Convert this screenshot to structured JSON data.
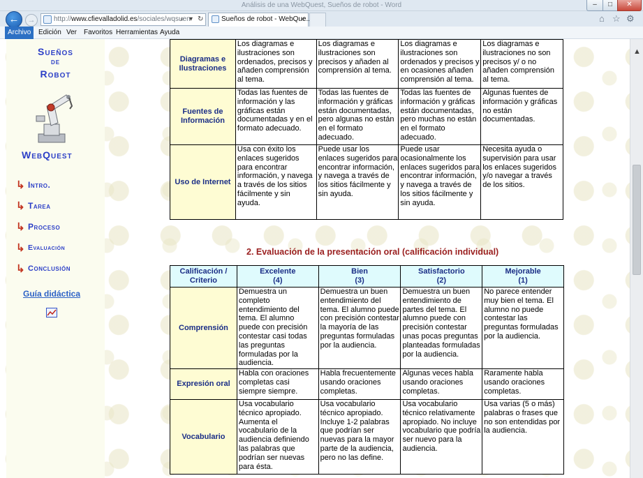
{
  "window": {
    "title": "Análisis de una WebQuest, Sueños de robot - Word"
  },
  "browser": {
    "address_domain": "www.cfievalladolid.es",
    "address_path": "/sociales/wqsuen",
    "address_prefix": "http://",
    "tab_title": "Sueños de robot - WebQue...",
    "tab_close": "×"
  },
  "menu": [
    "Archivo",
    "Edición",
    "Ver",
    "Favoritos",
    "Herramientas",
    "Ayuda"
  ],
  "sidebar": {
    "logo": [
      "Sueños",
      "de",
      "Robot"
    ],
    "webquest_label": "WebQuest",
    "nav": [
      "Intro.",
      "Tarea",
      "Proceso",
      "Evaluación",
      "Conclusión"
    ],
    "guia_label": "Guía didáctica"
  },
  "table1": {
    "rows": [
      {
        "criterion": "Diagramas e Ilustraciones",
        "cells": [
          "Los diagramas e ilustraciones son ordenados, precisos y añaden comprensión al tema.",
          "Los diagramas e ilustraciones son precisos y añaden al comprensión al tema.",
          "Los diagramas e ilustraciones son ordenados y precisos y en ocasiones añaden comprensión al tema.",
          "Los diagramas e ilustraciones no son precisos y/ o no añaden comprensión al tema."
        ]
      },
      {
        "criterion": "Fuentes de Información",
        "cells": [
          "Todas las fuentes de información y las gráficas están documentadas y en el formato adecuado.",
          "Todas las fuentes de información y gráficas están documentadas, pero algunas no están en el formato adecuado.",
          "Todas las fuentes de información y gráficas están documentadas, pero muchas no están en el formato adecuado.",
          "Algunas fuentes de información y gráficas no están documentadas."
        ]
      },
      {
        "criterion": "Uso de Internet",
        "cells": [
          "Usa con éxito los enlaces sugeridos para encontrar información, y navega a través de los sitios fácilmente y sin ayuda.",
          "Puede usar los enlaces sugeridos para encontrar información, y navega a través de los sitios fácilmente y sin ayuda.",
          "Puede usar ocasionalmente los enlaces sugeridos para encontrar información, y navega a través de los sitios fácilmente y sin ayuda.",
          "Necesita ayuda o supervisión para usar los enlaces sugeridos y/o navegar a través de los sitios."
        ]
      }
    ]
  },
  "section2_title": "2. Evaluación de la presentación oral (calificación individual)",
  "table2": {
    "headers": [
      [
        "Calificación /",
        "Criterio"
      ],
      [
        "Excelente",
        "(4)"
      ],
      [
        "Bien",
        "(3)"
      ],
      [
        "Satisfactorio",
        "(2)"
      ],
      [
        "Mejorable",
        "(1)"
      ]
    ],
    "rows": [
      {
        "criterion": "Comprensión",
        "cells": [
          "Demuestra un completo entendimiento del tema. El alumno puede con precisión contestar casi todas las preguntas formuladas por la audiencia.",
          "Demuestra un buen entendimiento del tema. El alumno puede con precisión contestar la mayoría de las preguntas formuladas por la audiencia.",
          "Demuestra un buen entendimiento de partes del tema. El alumno puede con precisión contestar unas pocas preguntas planteadas formuladas por la audiencia.",
          "No parece entender muy bien el tema. El alumno no puede contestar las preguntas formuladas por la audiencia."
        ]
      },
      {
        "criterion": "Expresión oral",
        "cells": [
          "Habla con oraciones completas casi siempre siempre.",
          "Habla frecuentemente usando oraciones completas.",
          "Algunas veces habla usando oraciones completas.",
          "Raramente habla usando oraciones completas."
        ]
      },
      {
        "criterion": "Vocabulario",
        "cells": [
          "Usa vocabulario técnico apropiado. Aumenta el vocabulario de la audiencia definiendo las palabras que podrían ser nuevas para ésta.",
          "Usa vocabulario técnico apropiado. Incluye 1-2 palabras que podrían ser nuevas para la mayor parte de la audiencia, pero no las define.",
          "Usa vocabulario técnico relativamente apropiado. No incluye vocabulario que podría ser nuevo para la audiencia.",
          "Usa varias (5 o más) palabras o frases que no son entendidas por la audiencia."
        ]
      }
    ]
  }
}
